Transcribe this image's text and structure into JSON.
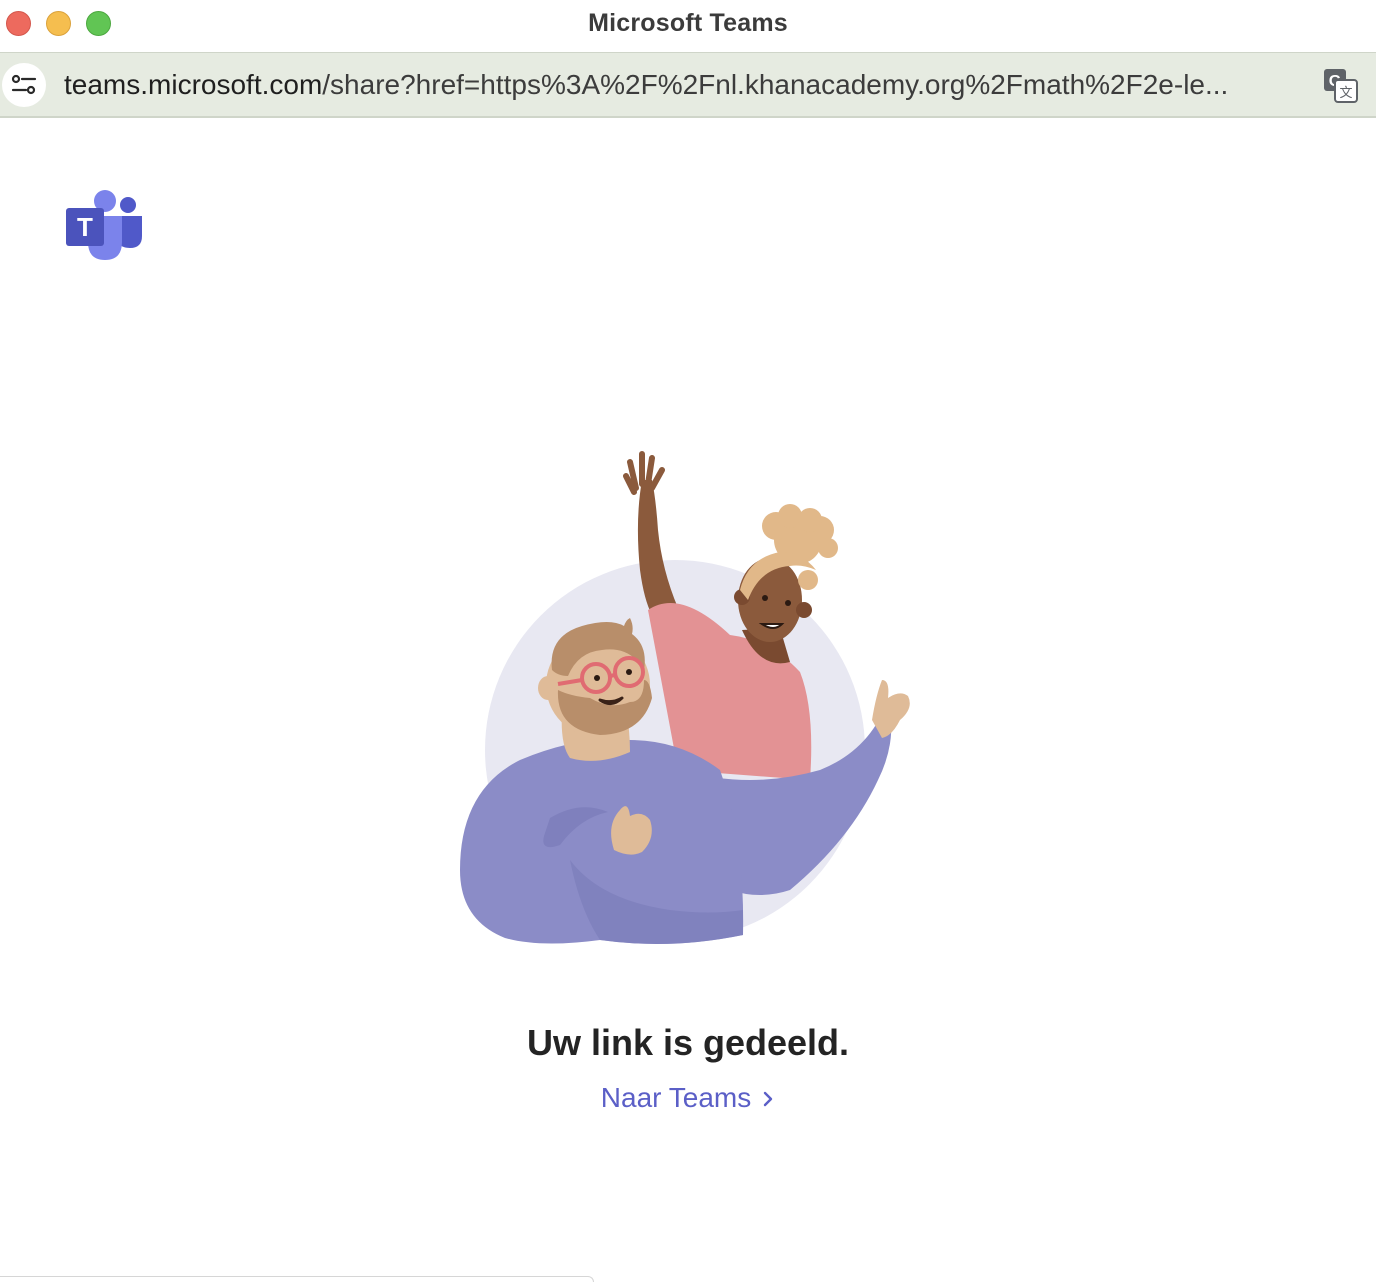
{
  "window": {
    "title": "Microsoft Teams"
  },
  "address_bar": {
    "host": "teams.microsoft.com",
    "path": "/share?href=https%3A%2F%2Fnl.khanacademy.org%2Fmath%2F2e-le..."
  },
  "icons": {
    "site_settings": "tune-icon",
    "translate": "translate-icon",
    "logo": "microsoft-teams-logo",
    "link_arrow": "chevron-right-icon"
  },
  "main": {
    "headline": "Uw link is gedeeld.",
    "link_label": "Naar Teams"
  },
  "colors": {
    "accent": "#5b5fc7",
    "headline": "#242424"
  }
}
